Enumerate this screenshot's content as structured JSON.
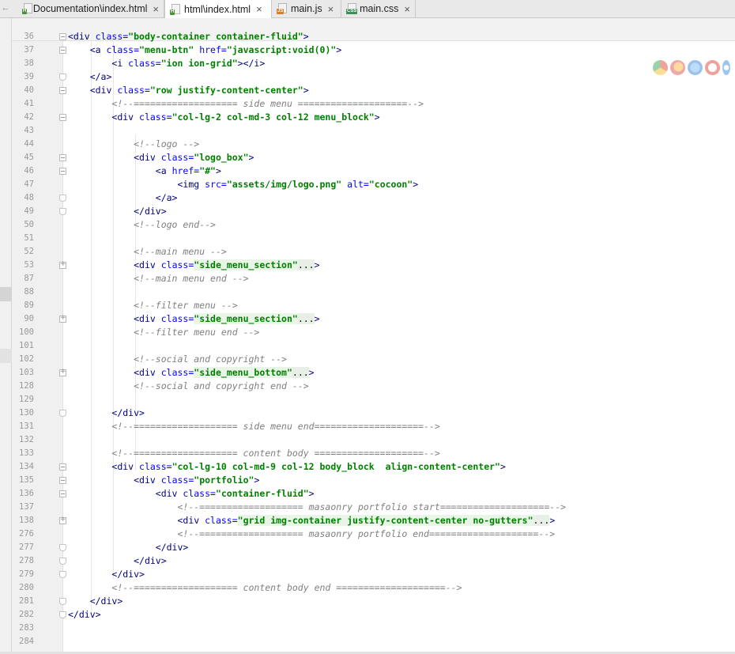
{
  "tabs": [
    {
      "label": "Documentation\\index.html",
      "type": "H",
      "active": false
    },
    {
      "label": "html\\index.html",
      "type": "H",
      "active": true
    },
    {
      "label": "main.js",
      "type": "JS",
      "active": false
    },
    {
      "label": "main.css",
      "type": "CSS",
      "active": false
    }
  ],
  "tab_close_glyph": "×",
  "lines": [
    {
      "n": "36",
      "fold": "open",
      "segs": [
        {
          "t": "tag",
          "v": "<div "
        },
        {
          "t": "attr",
          "v": "class="
        },
        {
          "t": "str",
          "v": "\"body-container container-fluid\""
        },
        {
          "t": "tag",
          "v": ">"
        }
      ]
    },
    {
      "n": "37",
      "fold": "open",
      "segs": [
        {
          "t": "sp",
          "v": "    "
        },
        {
          "t": "tag",
          "v": "<a "
        },
        {
          "t": "attr",
          "v": "class="
        },
        {
          "t": "str",
          "v": "\"menu-btn\""
        },
        {
          "t": "attr",
          "v": " href="
        },
        {
          "t": "str",
          "v": "\"javascript:void(0)\""
        },
        {
          "t": "tag",
          "v": ">"
        }
      ]
    },
    {
      "n": "38",
      "fold": "",
      "segs": [
        {
          "t": "sp",
          "v": "        "
        },
        {
          "t": "tag",
          "v": "<i "
        },
        {
          "t": "attr",
          "v": "class="
        },
        {
          "t": "str",
          "v": "\"ion ion-grid\""
        },
        {
          "t": "tag",
          "v": "></i>"
        }
      ]
    },
    {
      "n": "39",
      "fold": "end",
      "segs": [
        {
          "t": "sp",
          "v": "    "
        },
        {
          "t": "tag",
          "v": "</a>"
        }
      ]
    },
    {
      "n": "40",
      "fold": "open",
      "segs": [
        {
          "t": "sp",
          "v": "    "
        },
        {
          "t": "tag",
          "v": "<div "
        },
        {
          "t": "attr",
          "v": "class="
        },
        {
          "t": "str",
          "v": "\"row justify-content-center\""
        },
        {
          "t": "tag",
          "v": ">"
        }
      ]
    },
    {
      "n": "41",
      "fold": "",
      "segs": [
        {
          "t": "sp",
          "v": "        "
        },
        {
          "t": "cmt",
          "v": "<!--=================== side menu ====================-->"
        }
      ]
    },
    {
      "n": "42",
      "fold": "open",
      "segs": [
        {
          "t": "sp",
          "v": "        "
        },
        {
          "t": "tag",
          "v": "<div "
        },
        {
          "t": "attr",
          "v": "class="
        },
        {
          "t": "str",
          "v": "\"col-lg-2 col-md-3 col-12 menu_block\""
        },
        {
          "t": "tag",
          "v": ">"
        }
      ]
    },
    {
      "n": "43",
      "fold": "",
      "segs": []
    },
    {
      "n": "44",
      "fold": "",
      "segs": [
        {
          "t": "sp",
          "v": "            "
        },
        {
          "t": "cmt",
          "v": "<!--logo -->"
        }
      ]
    },
    {
      "n": "45",
      "fold": "open",
      "segs": [
        {
          "t": "sp",
          "v": "            "
        },
        {
          "t": "tag",
          "v": "<div "
        },
        {
          "t": "attr",
          "v": "class="
        },
        {
          "t": "str",
          "v": "\"logo_box\""
        },
        {
          "t": "tag",
          "v": ">"
        }
      ]
    },
    {
      "n": "46",
      "fold": "open",
      "segs": [
        {
          "t": "sp",
          "v": "                "
        },
        {
          "t": "tag",
          "v": "<a "
        },
        {
          "t": "attr",
          "v": "href="
        },
        {
          "t": "str",
          "v": "\"#\""
        },
        {
          "t": "tag",
          "v": ">"
        }
      ]
    },
    {
      "n": "47",
      "fold": "",
      "segs": [
        {
          "t": "sp",
          "v": "                    "
        },
        {
          "t": "tag",
          "v": "<img "
        },
        {
          "t": "attr",
          "v": "src="
        },
        {
          "t": "str",
          "v": "\"assets/img/logo.png\""
        },
        {
          "t": "attr",
          "v": " alt="
        },
        {
          "t": "str",
          "v": "\"cocoon\""
        },
        {
          "t": "tag",
          "v": ">"
        }
      ]
    },
    {
      "n": "48",
      "fold": "end",
      "segs": [
        {
          "t": "sp",
          "v": "                "
        },
        {
          "t": "tag",
          "v": "</a>"
        }
      ]
    },
    {
      "n": "49",
      "fold": "end",
      "segs": [
        {
          "t": "sp",
          "v": "            "
        },
        {
          "t": "tag",
          "v": "</div>"
        }
      ]
    },
    {
      "n": "50",
      "fold": "",
      "segs": [
        {
          "t": "sp",
          "v": "            "
        },
        {
          "t": "cmt",
          "v": "<!--logo end-->"
        }
      ]
    },
    {
      "n": "51",
      "fold": "",
      "segs": []
    },
    {
      "n": "52",
      "fold": "",
      "segs": [
        {
          "t": "sp",
          "v": "            "
        },
        {
          "t": "cmt",
          "v": "<!--main menu -->"
        }
      ]
    },
    {
      "n": "53",
      "fold": "plus",
      "segs": [
        {
          "t": "sp",
          "v": "            "
        },
        {
          "t": "tag",
          "v": "<div "
        },
        {
          "t": "attr",
          "v": "class="
        },
        {
          "t": "strf",
          "v": "\"side_menu_section\""
        },
        {
          "t": "ell",
          "v": "..."
        },
        {
          "t": "tag",
          "v": ">"
        }
      ]
    },
    {
      "n": "87",
      "fold": "",
      "segs": [
        {
          "t": "sp",
          "v": "            "
        },
        {
          "t": "cmt",
          "v": "<!--main menu end -->"
        }
      ]
    },
    {
      "n": "88",
      "fold": "",
      "segs": []
    },
    {
      "n": "89",
      "fold": "",
      "segs": [
        {
          "t": "sp",
          "v": "            "
        },
        {
          "t": "cmt",
          "v": "<!--filter menu -->"
        }
      ]
    },
    {
      "n": "90",
      "fold": "plus",
      "segs": [
        {
          "t": "sp",
          "v": "            "
        },
        {
          "t": "tag",
          "v": "<div "
        },
        {
          "t": "attr",
          "v": "class="
        },
        {
          "t": "strf",
          "v": "\"side_menu_section\""
        },
        {
          "t": "ell",
          "v": "..."
        },
        {
          "t": "tag",
          "v": ">"
        }
      ]
    },
    {
      "n": "100",
      "fold": "",
      "segs": [
        {
          "t": "sp",
          "v": "            "
        },
        {
          "t": "cmt",
          "v": "<!--filter menu end -->"
        }
      ]
    },
    {
      "n": "101",
      "fold": "",
      "segs": []
    },
    {
      "n": "102",
      "fold": "",
      "segs": [
        {
          "t": "sp",
          "v": "            "
        },
        {
          "t": "cmt",
          "v": "<!--social and copyright -->"
        }
      ]
    },
    {
      "n": "103",
      "fold": "plus",
      "segs": [
        {
          "t": "sp",
          "v": "            "
        },
        {
          "t": "tag",
          "v": "<div "
        },
        {
          "t": "attr",
          "v": "class="
        },
        {
          "t": "strf",
          "v": "\"side_menu_bottom\""
        },
        {
          "t": "ell",
          "v": "..."
        },
        {
          "t": "tag",
          "v": ">"
        }
      ]
    },
    {
      "n": "128",
      "fold": "",
      "segs": [
        {
          "t": "sp",
          "v": "            "
        },
        {
          "t": "cmt",
          "v": "<!--social and copyright end -->"
        }
      ]
    },
    {
      "n": "129",
      "fold": "",
      "segs": []
    },
    {
      "n": "130",
      "fold": "end",
      "segs": [
        {
          "t": "sp",
          "v": "        "
        },
        {
          "t": "tag",
          "v": "</div>"
        }
      ]
    },
    {
      "n": "131",
      "fold": "",
      "segs": [
        {
          "t": "sp",
          "v": "        "
        },
        {
          "t": "cmt",
          "v": "<!--=================== side menu end====================-->"
        }
      ]
    },
    {
      "n": "132",
      "fold": "",
      "segs": []
    },
    {
      "n": "133",
      "fold": "",
      "segs": [
        {
          "t": "sp",
          "v": "        "
        },
        {
          "t": "cmt",
          "v": "<!--=================== content body ====================-->"
        }
      ]
    },
    {
      "n": "134",
      "fold": "open",
      "segs": [
        {
          "t": "sp",
          "v": "        "
        },
        {
          "t": "tag",
          "v": "<div "
        },
        {
          "t": "attr",
          "v": "class="
        },
        {
          "t": "str",
          "v": "\"col-lg-10 col-md-9 col-12 body_block  align-content-center\""
        },
        {
          "t": "tag",
          "v": ">"
        }
      ]
    },
    {
      "n": "135",
      "fold": "open",
      "segs": [
        {
          "t": "sp",
          "v": "            "
        },
        {
          "t": "tag",
          "v": "<div "
        },
        {
          "t": "attr",
          "v": "class="
        },
        {
          "t": "str",
          "v": "\"portfolio\""
        },
        {
          "t": "tag",
          "v": ">"
        }
      ]
    },
    {
      "n": "136",
      "fold": "open",
      "segs": [
        {
          "t": "sp",
          "v": "                "
        },
        {
          "t": "tag",
          "v": "<div "
        },
        {
          "t": "attr",
          "v": "class="
        },
        {
          "t": "str",
          "v": "\"container-fluid\""
        },
        {
          "t": "tag",
          "v": ">"
        }
      ]
    },
    {
      "n": "137",
      "fold": "",
      "segs": [
        {
          "t": "sp",
          "v": "                    "
        },
        {
          "t": "cmt",
          "v": "<!--=================== masaonry portfolio start====================-->"
        }
      ]
    },
    {
      "n": "138",
      "fold": "plus",
      "segs": [
        {
          "t": "sp",
          "v": "                    "
        },
        {
          "t": "tag",
          "v": "<div "
        },
        {
          "t": "attr",
          "v": "class="
        },
        {
          "t": "strf",
          "v": "\"grid img-container justify-content-center no-gutters\""
        },
        {
          "t": "ell",
          "v": "..."
        },
        {
          "t": "tag",
          "v": ">"
        }
      ]
    },
    {
      "n": "276",
      "fold": "",
      "segs": [
        {
          "t": "sp",
          "v": "                    "
        },
        {
          "t": "cmt",
          "v": "<!--=================== masaonry portfolio end====================-->"
        }
      ]
    },
    {
      "n": "277",
      "fold": "end",
      "segs": [
        {
          "t": "sp",
          "v": "                "
        },
        {
          "t": "tag",
          "v": "</div>"
        }
      ]
    },
    {
      "n": "278",
      "fold": "end",
      "segs": [
        {
          "t": "sp",
          "v": "            "
        },
        {
          "t": "tag",
          "v": "</div>"
        }
      ]
    },
    {
      "n": "279",
      "fold": "end",
      "segs": [
        {
          "t": "sp",
          "v": "        "
        },
        {
          "t": "tag",
          "v": "</div>"
        }
      ]
    },
    {
      "n": "280",
      "fold": "",
      "segs": [
        {
          "t": "sp",
          "v": "        "
        },
        {
          "t": "cmt",
          "v": "<!--=================== content body end ====================-->"
        }
      ]
    },
    {
      "n": "281",
      "fold": "end",
      "segs": [
        {
          "t": "sp",
          "v": "    "
        },
        {
          "t": "tag",
          "v": "</div>"
        }
      ]
    },
    {
      "n": "282",
      "fold": "end",
      "segs": [
        {
          "t": "tag",
          "v": "</div>"
        }
      ]
    },
    {
      "n": "283",
      "fold": "",
      "segs": []
    },
    {
      "n": "284",
      "fold": "",
      "segs": []
    }
  ],
  "browser_icons": [
    "chrome-icon",
    "firefox-icon",
    "safari-icon",
    "opera-icon",
    "ie-icon"
  ]
}
